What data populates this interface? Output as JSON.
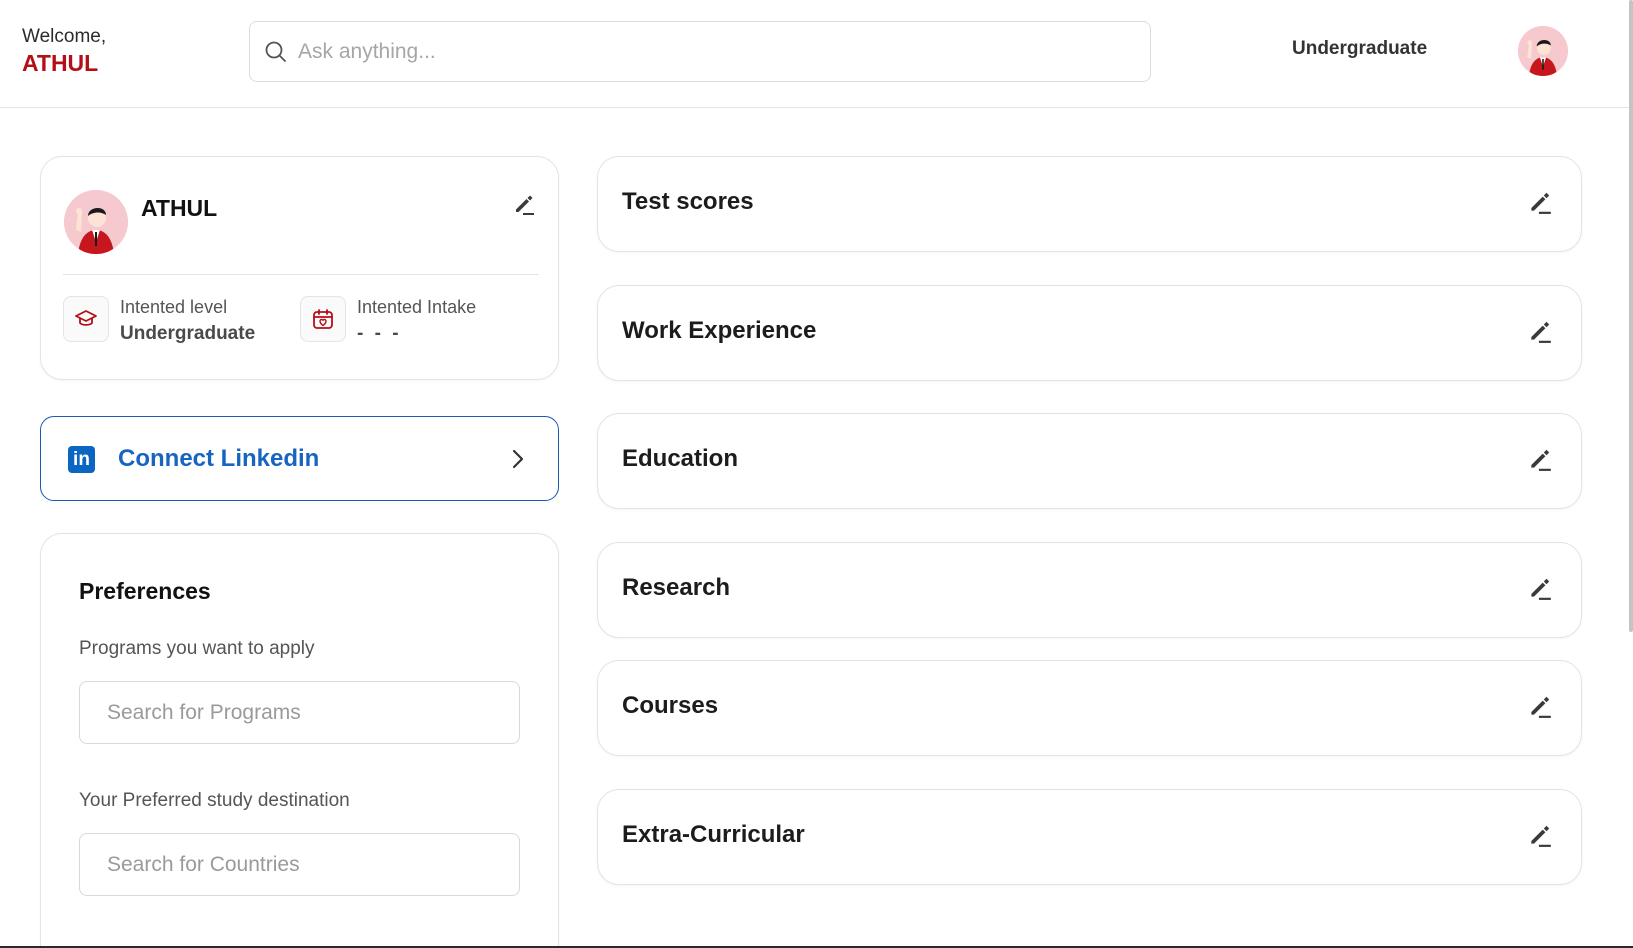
{
  "header": {
    "welcome_label": "Welcome,",
    "user_name": "ATHUL",
    "search_placeholder": "Ask anything...",
    "level": "Undergraduate"
  },
  "profile": {
    "name": "ATHUL",
    "intended_level_label": "Intented level",
    "intended_level_value": "Undergraduate",
    "intended_intake_label": "Intented Intake",
    "intended_intake_value": "- - -"
  },
  "linkedin": {
    "label": "Connect Linkedin",
    "logo_text": "in"
  },
  "preferences": {
    "title": "Preferences",
    "programs_question": "Programs you want to apply",
    "programs_placeholder": "Search for Programs",
    "destination_question": "Your Preferred study destination",
    "destination_placeholder": "Search for Countries"
  },
  "sections": [
    {
      "title": "Test scores"
    },
    {
      "title": "Work Experience"
    },
    {
      "title": "Education"
    },
    {
      "title": "Research"
    },
    {
      "title": "Courses"
    },
    {
      "title": "Extra-Curricular"
    }
  ],
  "colors": {
    "brand_red": "#b30f17",
    "linkedin_blue": "#0a66c2",
    "linkedin_text": "#1765c1",
    "avatar_bg": "#f6c9cf"
  },
  "icons": {
    "search": "search-icon",
    "edit": "pencil-icon",
    "level": "graduation-cap-icon",
    "intake": "calendar-heart-icon",
    "linkedin": "linkedin-icon",
    "chevron": "chevron-right-icon"
  }
}
